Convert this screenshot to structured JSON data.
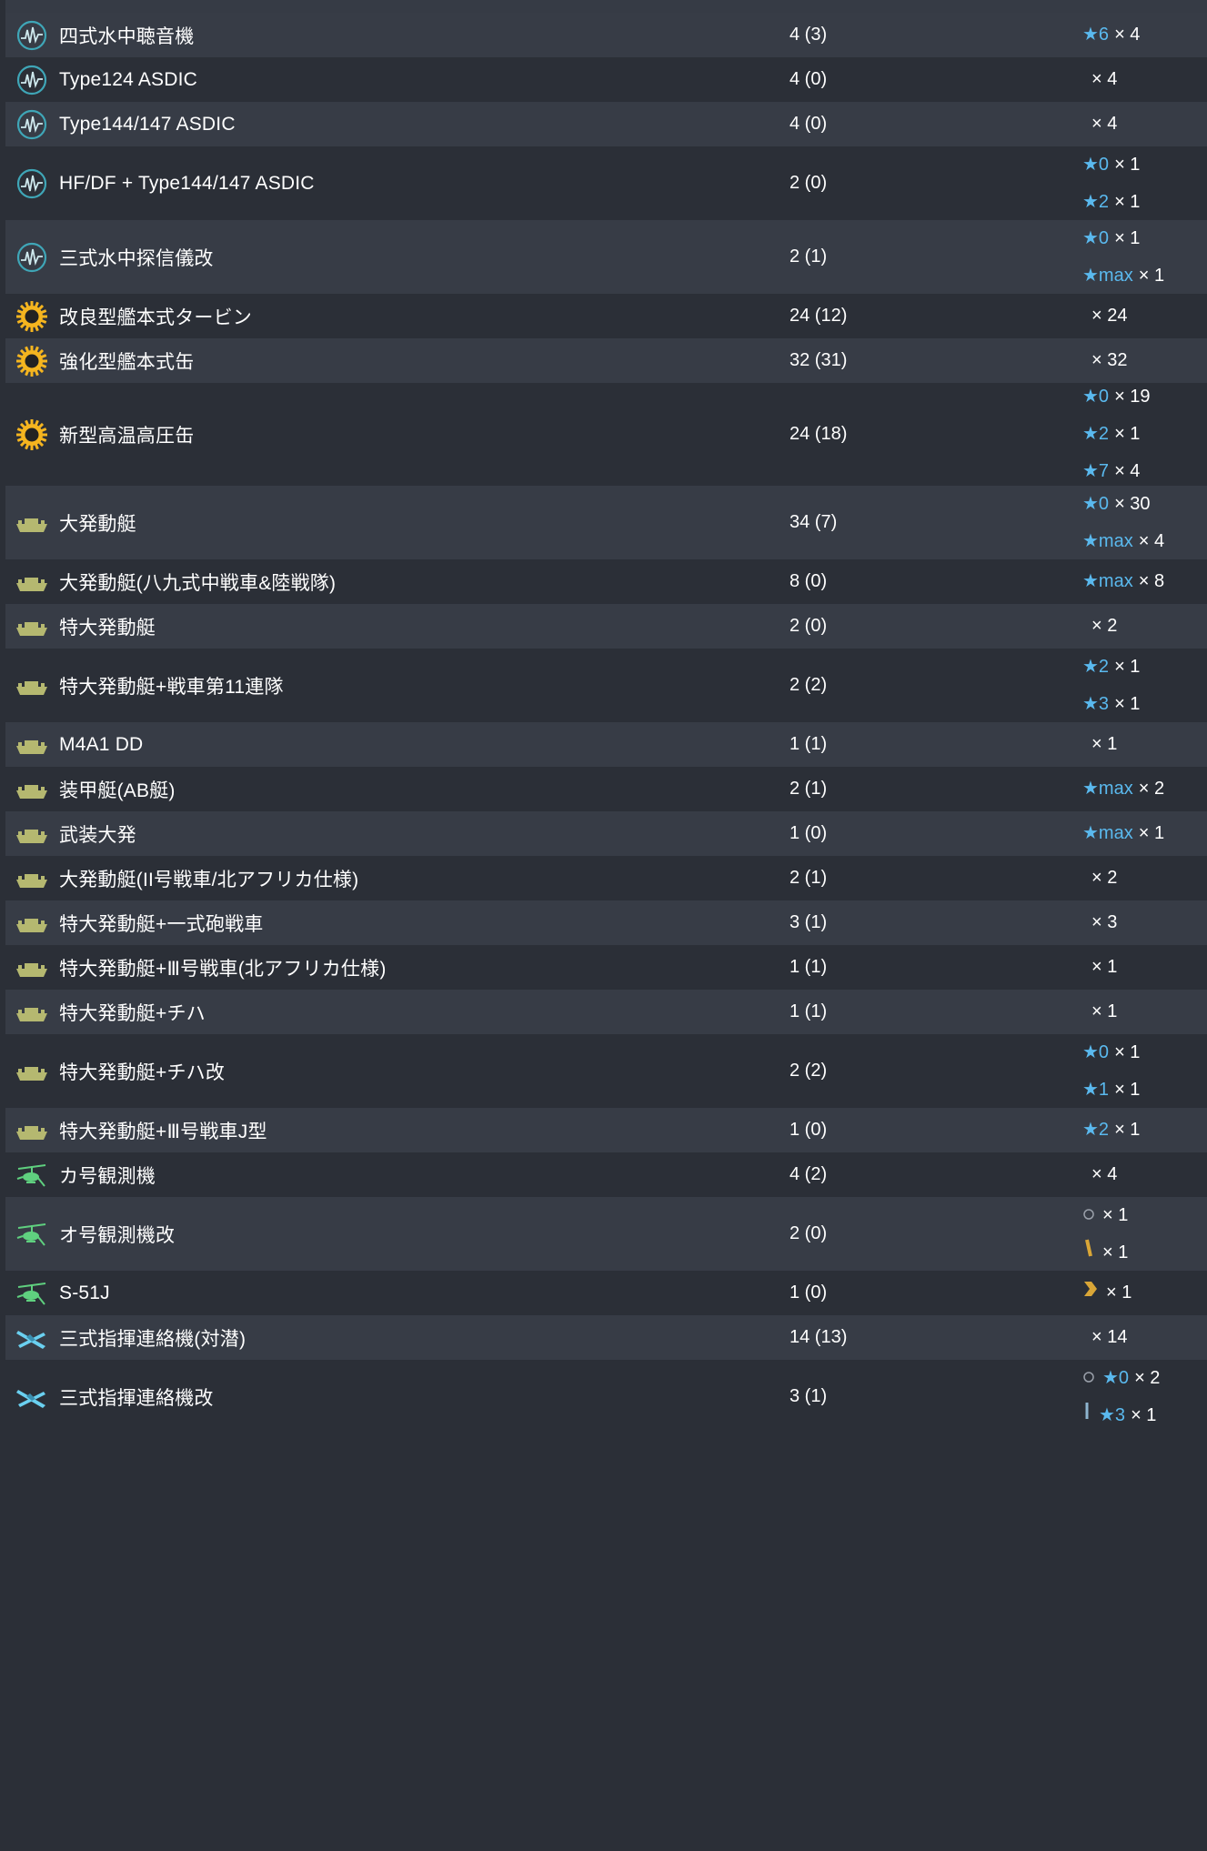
{
  "colors": {
    "bg_dark": "#2b2f37",
    "bg_light": "#373c46",
    "star": "#5ab9ee",
    "sonar": "#3fa6b7",
    "turbine": "#f5b51f",
    "landing": "#b5b870",
    "autogyro": "#5fd07f",
    "liaison": "#6ad0f0",
    "prof_gold": "#d9a637"
  },
  "rows": [
    {
      "name": "四式水中聴音機",
      "icon": "sonar-icon",
      "count": "4 (3)",
      "imps": [
        {
          "star": "★6",
          "mult": "× 4"
        }
      ]
    },
    {
      "name": "Type124 ASDIC",
      "icon": "sonar-icon",
      "count": "4 (0)",
      "imps": [
        {
          "star": "",
          "mult": "× 4"
        }
      ]
    },
    {
      "name": "Type144/147 ASDIC",
      "icon": "sonar-icon",
      "count": "4 (0)",
      "imps": [
        {
          "star": "",
          "mult": "× 4"
        }
      ]
    },
    {
      "name": "HF/DF + Type144/147 ASDIC",
      "icon": "sonar-icon",
      "count": "2 (0)",
      "imps": [
        {
          "star": "★0",
          "mult": "× 1"
        },
        {
          "star": "★2",
          "mult": "× 1"
        }
      ]
    },
    {
      "name": "三式水中探信儀改",
      "icon": "sonar-icon",
      "count": "2 (1)",
      "imps": [
        {
          "star": "★0",
          "mult": "× 1"
        },
        {
          "star": "★max",
          "mult": "× 1"
        }
      ]
    },
    {
      "name": "改良型艦本式タービン",
      "icon": "turbine-icon",
      "count": "24 (12)",
      "imps": [
        {
          "star": "",
          "mult": "× 24"
        }
      ]
    },
    {
      "name": "強化型艦本式缶",
      "icon": "turbine-icon",
      "count": "32 (31)",
      "imps": [
        {
          "star": "",
          "mult": "× 32"
        }
      ]
    },
    {
      "name": "新型高温高圧缶",
      "icon": "turbine-icon",
      "count": "24 (18)",
      "imps": [
        {
          "star": "★0",
          "mult": "× 19"
        },
        {
          "star": "★2",
          "mult": "× 1"
        },
        {
          "star": "★7",
          "mult": "× 4"
        }
      ]
    },
    {
      "name": "大発動艇",
      "icon": "landing-craft-icon",
      "count": "34 (7)",
      "imps": [
        {
          "star": "★0",
          "mult": "× 30"
        },
        {
          "star": "★max",
          "mult": "× 4"
        }
      ]
    },
    {
      "name": "大発動艇(八九式中戦車&陸戦隊)",
      "icon": "landing-craft-icon",
      "count": "8 (0)",
      "imps": [
        {
          "star": "★max",
          "mult": "× 8"
        }
      ]
    },
    {
      "name": "特大発動艇",
      "icon": "landing-craft-icon",
      "count": "2 (0)",
      "imps": [
        {
          "star": "",
          "mult": "× 2"
        }
      ]
    },
    {
      "name": "特大発動艇+戦車第11連隊",
      "icon": "landing-craft-icon",
      "count": "2 (2)",
      "imps": [
        {
          "star": "★2",
          "mult": "× 1"
        },
        {
          "star": "★3",
          "mult": "× 1"
        }
      ]
    },
    {
      "name": "M4A1 DD",
      "icon": "landing-craft-icon",
      "count": "1 (1)",
      "imps": [
        {
          "star": "",
          "mult": "× 1"
        }
      ]
    },
    {
      "name": "装甲艇(AB艇)",
      "icon": "landing-craft-icon",
      "count": "2 (1)",
      "imps": [
        {
          "star": "★max",
          "mult": "× 2"
        }
      ]
    },
    {
      "name": "武装大発",
      "icon": "landing-craft-icon",
      "count": "1 (0)",
      "imps": [
        {
          "star": "★max",
          "mult": "× 1"
        }
      ]
    },
    {
      "name": "大発動艇(II号戦車/北アフリカ仕様)",
      "icon": "landing-craft-icon",
      "count": "2 (1)",
      "imps": [
        {
          "star": "",
          "mult": "× 2"
        }
      ]
    },
    {
      "name": "特大発動艇+一式砲戦車",
      "icon": "landing-craft-icon",
      "count": "3 (1)",
      "imps": [
        {
          "star": "",
          "mult": "× 3"
        }
      ]
    },
    {
      "name": "特大発動艇+Ⅲ号戦車(北アフリカ仕様)",
      "icon": "landing-craft-icon",
      "count": "1 (1)",
      "imps": [
        {
          "star": "",
          "mult": "× 1"
        }
      ]
    },
    {
      "name": "特大発動艇+チハ",
      "icon": "landing-craft-icon",
      "count": "1 (1)",
      "imps": [
        {
          "star": "",
          "mult": "× 1"
        }
      ]
    },
    {
      "name": "特大発動艇+チハ改",
      "icon": "landing-craft-icon",
      "count": "2 (2)",
      "imps": [
        {
          "star": "★0",
          "mult": "× 1"
        },
        {
          "star": "★1",
          "mult": "× 1"
        }
      ]
    },
    {
      "name": "特大発動艇+Ⅲ号戦車J型",
      "icon": "landing-craft-icon",
      "count": "1 (0)",
      "imps": [
        {
          "star": "★2",
          "mult": "× 1"
        }
      ]
    },
    {
      "name": "カ号観測機",
      "icon": "autogyro-icon",
      "count": "4 (2)",
      "imps": [
        {
          "star": "",
          "mult": "× 4"
        }
      ]
    },
    {
      "name": "オ号観測機改",
      "icon": "autogyro-icon",
      "count": "2 (0)",
      "imps": [
        {
          "prof": "circle",
          "star": "",
          "mult": "× 1"
        },
        {
          "prof": "bar-gold",
          "star": "",
          "mult": "× 1"
        }
      ]
    },
    {
      "name": "S-51J",
      "icon": "autogyro-icon",
      "count": "1 (0)",
      "imps": [
        {
          "prof": "chevron-gold",
          "star": "",
          "mult": "× 1"
        }
      ]
    },
    {
      "name": "三式指揮連絡機(対潜)",
      "icon": "liaison-plane-icon",
      "count": "14 (13)",
      "imps": [
        {
          "star": "",
          "mult": "× 14"
        }
      ]
    },
    {
      "name": "三式指揮連絡機改",
      "icon": "liaison-plane-icon",
      "count": "3 (1)",
      "imps": [
        {
          "prof": "circle",
          "star": "★0",
          "mult": "× 2"
        },
        {
          "prof": "bar-blue",
          "star": "★3",
          "mult": "× 1"
        }
      ]
    }
  ]
}
